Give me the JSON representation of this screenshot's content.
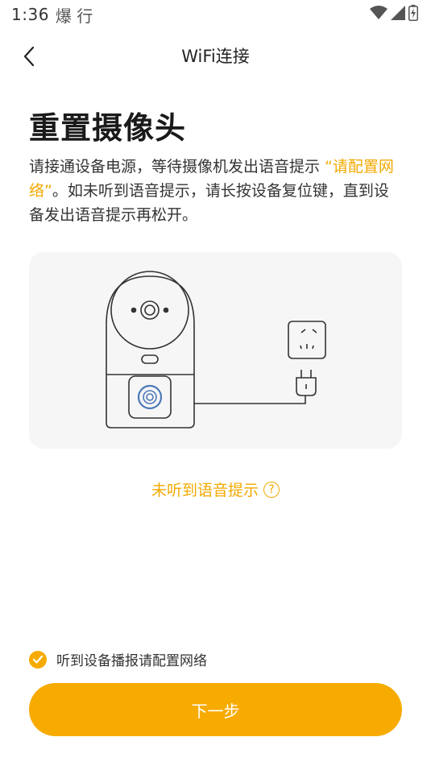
{
  "status_bar": {
    "time": "1:36",
    "app_indicator": "爆 行",
    "icons": [
      "wifi-icon",
      "signal-icon",
      "battery-icon"
    ]
  },
  "header": {
    "title": "WiFi连接",
    "back_icon": "chevron-left-icon"
  },
  "main": {
    "title": "重置摄像头",
    "description_part1": "请接通设备电源，等待摄像机发出语音提示 ",
    "description_highlight": "“请配置网络”",
    "description_part2": "。如未听到语音提示，请长按设备复位键，直到设备发出语音提示再松开。"
  },
  "illustration": {
    "items": [
      "camera-illustration",
      "power-outlet-illustration",
      "power-plug-illustration"
    ]
  },
  "help_link": {
    "label": "未听到语音提示",
    "icon": "question-circle-icon"
  },
  "confirm": {
    "label": "听到设备播报请配置网络",
    "checked": true
  },
  "next_button": {
    "label": "下一步"
  },
  "colors": {
    "accent": "#f7ab00",
    "highlight_text": "#f2a900",
    "card_bg": "#f6f6f6"
  }
}
